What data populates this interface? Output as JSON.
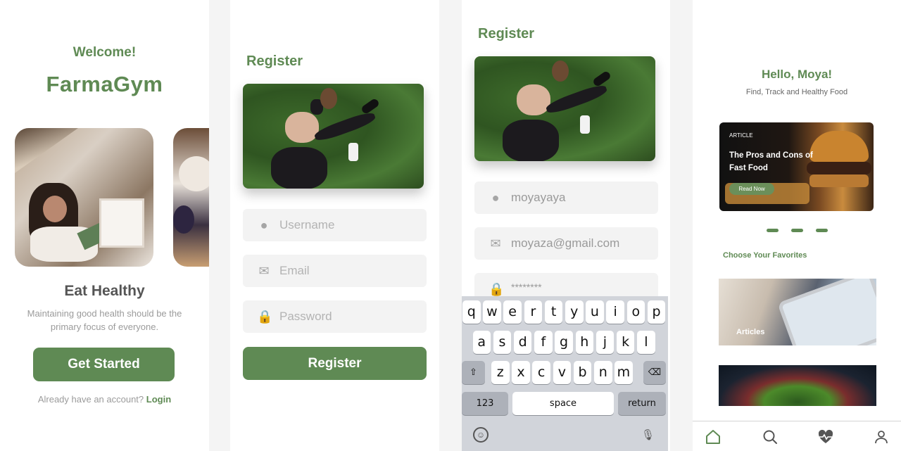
{
  "screen1": {
    "welcome": "Welcome!",
    "brand": "FarmaGym",
    "heading": "Eat Healthy",
    "description": "Maintaining good health should be the primary focus of everyone.",
    "cta": "Get Started",
    "login_prompt": "Already have an account?",
    "login_link": "Login"
  },
  "screen2": {
    "title": "Register",
    "username_placeholder": "Username",
    "email_placeholder": "Email",
    "password_placeholder": "Password",
    "submit": "Register"
  },
  "screen3": {
    "title": "Register",
    "username_value": "moyayaya",
    "email_value": "moyaza@gmail.com",
    "password_value": "********",
    "keyboard": {
      "row1": [
        "q",
        "w",
        "e",
        "r",
        "t",
        "y",
        "u",
        "i",
        "o",
        "p"
      ],
      "row2": [
        "a",
        "s",
        "d",
        "f",
        "g",
        "h",
        "j",
        "k",
        "l"
      ],
      "row3": [
        "z",
        "x",
        "c",
        "v",
        "b",
        "n",
        "m"
      ],
      "numbers_key": "123",
      "space_key": "space",
      "return_key": "return"
    }
  },
  "screen4": {
    "greeting": "Hello, Moya!",
    "subtitle": "Find, Track and Healthy Food",
    "banner": {
      "tag": "ARTICLE",
      "title": "The Pros and Cons of Fast Food",
      "button": "Read Now"
    },
    "section_title": "Choose Your Favorites",
    "cards": [
      "Articles"
    ],
    "tabs": [
      "home-icon",
      "search-icon",
      "heart-pulse-icon",
      "profile-icon"
    ],
    "accent": "#5f8a54"
  }
}
